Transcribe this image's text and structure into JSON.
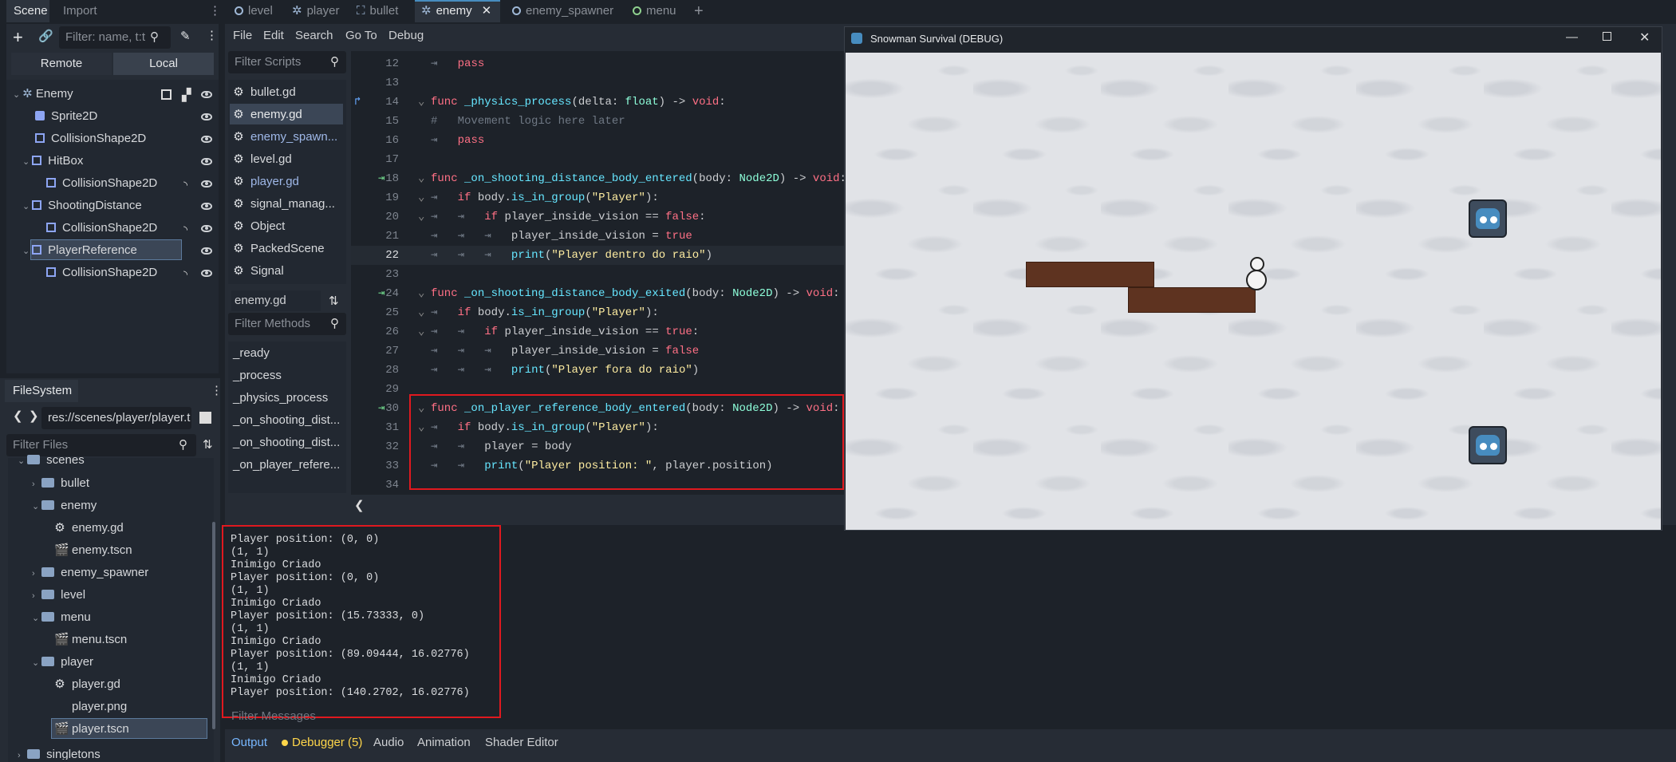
{
  "left_dock": {
    "tabs": [
      "Scene",
      "Import"
    ],
    "filter_placeholder": "Filter: name, t:t",
    "remote": "Remote",
    "local": "Local",
    "tree": [
      {
        "label": "Enemy"
      },
      {
        "label": "Sprite2D"
      },
      {
        "label": "CollisionShape2D"
      },
      {
        "label": "HitBox"
      },
      {
        "label": "CollisionShape2D"
      },
      {
        "label": "ShootingDistance"
      },
      {
        "label": "CollisionShape2D"
      },
      {
        "label": "PlayerReference"
      },
      {
        "label": "CollisionShape2D"
      }
    ]
  },
  "filesystem": {
    "title": "FileSystem",
    "path": "res://scenes/player/player.t",
    "filter_placeholder": "Filter Files",
    "items": [
      {
        "label": "scenes"
      },
      {
        "label": "bullet"
      },
      {
        "label": "enemy"
      },
      {
        "label": "enemy.gd"
      },
      {
        "label": "enemy.tscn"
      },
      {
        "label": "enemy_spawner"
      },
      {
        "label": "level"
      },
      {
        "label": "menu"
      },
      {
        "label": "menu.tscn"
      },
      {
        "label": "player"
      },
      {
        "label": "player.gd"
      },
      {
        "label": "player.png"
      },
      {
        "label": "player.tscn"
      },
      {
        "label": "singletons"
      }
    ]
  },
  "editor_tabs": [
    "level",
    "player",
    "bullet",
    "enemy",
    "enemy_spawner",
    "menu"
  ],
  "menu": [
    "File",
    "Edit",
    "Search",
    "Go To",
    "Debug"
  ],
  "scripts": {
    "filter_placeholder": "Filter Scripts",
    "list": [
      "bullet.gd",
      "enemy.gd",
      "enemy_spawn...",
      "level.gd",
      "player.gd",
      "signal_manag...",
      "Object",
      "PackedScene",
      "Signal"
    ],
    "current": "enemy.gd",
    "methods_placeholder": "Filter Methods",
    "methods": [
      "_ready",
      "_process",
      "_physics_process",
      "_on_shooting_dist...",
      "_on_shooting_dist...",
      "_on_player_refere..."
    ]
  },
  "code": {
    "numbers": [
      "12",
      "13",
      "14",
      "15",
      "16",
      "17",
      "18",
      "19",
      "20",
      "21",
      "22",
      "23",
      "24",
      "25",
      "26",
      "27",
      "28",
      "29",
      "30",
      "31",
      "32",
      "33",
      "34"
    ]
  },
  "output": {
    "lines": [
      "Player position: (0, 0)",
      "(1, 1)",
      "Inimigo Criado",
      "Player position: (0, 0)",
      "(1, 1)",
      "Inimigo Criado",
      "Player position: (15.73333, 0)",
      "(1, 1)",
      "Inimigo Criado",
      "Player position: (89.09444, 16.02776)",
      "(1, 1)",
      "Inimigo Criado",
      "Player position: (140.2702, 16.02776)"
    ],
    "filter_placeholder": "Filter Messages"
  },
  "bottom_tabs": [
    "Output",
    "Debugger (5)",
    "Audio",
    "Animation",
    "Shader Editor"
  ],
  "game_window": {
    "title": "Snowman Survival (DEBUG)"
  },
  "colors": {
    "accent": "#478cbf",
    "highlight_box": "#e0191f"
  }
}
